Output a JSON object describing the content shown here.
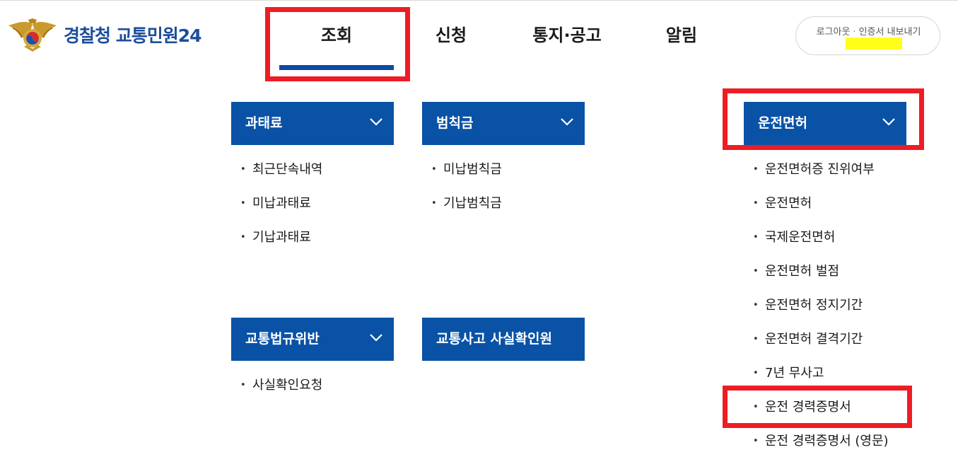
{
  "header": {
    "logo_text": "경찰청 교통민원24",
    "nav": [
      "조회",
      "신청",
      "통지·공고",
      "알림"
    ],
    "user_links": [
      "로그아웃",
      "인증서 내보내기"
    ],
    "user_links_separator": "·",
    "user_name_highlight_color": "#ffff1a"
  },
  "colors": {
    "brand_blue": "#0a52a6",
    "annotation_red": "#ee1c24"
  },
  "menus": {
    "fine": {
      "title": "과태료",
      "icon": "chevron-down-icon",
      "items": [
        "최근단속내역",
        "미납과태료",
        "기납과태료"
      ]
    },
    "penalty": {
      "title": "범칙금",
      "icon": "chevron-down-icon",
      "items": [
        "미납범칙금",
        "기납범칙금"
      ]
    },
    "license": {
      "title": "운전면허",
      "icon": "chevron-down-icon",
      "items": [
        "운전면허증 진위여부",
        "운전면허",
        "국제운전면허",
        "운전면허 벌점",
        "운전면허 정지기간",
        "운전면허 결격기간",
        "7년 무사고",
        "운전 경력증명서",
        "운전 경력증명서 (영문)"
      ]
    },
    "violation": {
      "title": "교통법규위반",
      "icon": "chevron-down-icon",
      "items": [
        "사실확인요청"
      ]
    },
    "accident": {
      "title": "교통사고 사실확인원"
    }
  }
}
